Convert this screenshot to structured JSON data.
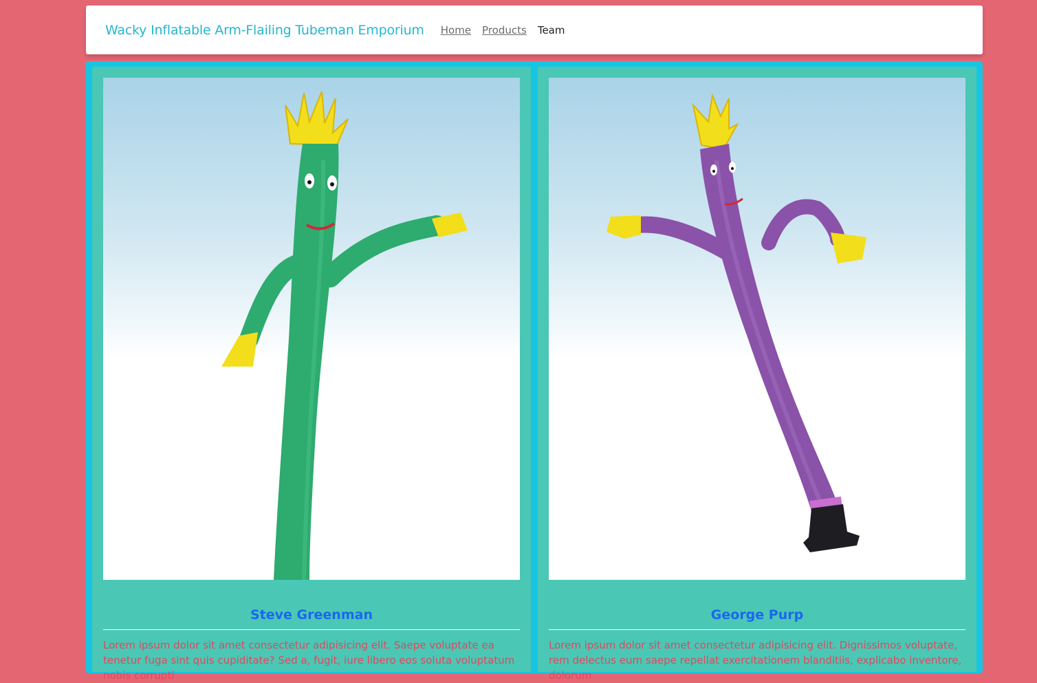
{
  "navbar": {
    "brand": "Wacky Inflatable Arm-Flailing Tubeman Emporium",
    "links": [
      {
        "label": "Home",
        "active": false
      },
      {
        "label": "Products",
        "active": false
      },
      {
        "label": "Team",
        "active": true
      }
    ]
  },
  "team": [
    {
      "name": "Steve Greenman",
      "image_icon": "green-tubeman-image",
      "tube_color": "#2eab6f",
      "description": "Lorem ipsum dolor sit amet consectetur adipisicing elit. Saepe voluptate ea tenetur fuga sint quis cupiditate? Sed a, fugit, iure libero eos soluta voluptatum nobis corrupti"
    },
    {
      "name": "George Purp",
      "image_icon": "purple-tubeman-image",
      "tube_color": "#8a52a8",
      "description": "Lorem ipsum dolor sit amet consectetur adipisicing elit. Dignissimos voluptate, rem delectus eum saepe repellat exercitationem blanditiis, explicabo inventore, dolorum"
    }
  ],
  "colors": {
    "page_background": "#e46672",
    "brand": "#25b6cf",
    "container": "#17c5e3",
    "card": "#4bc7b5",
    "member_name": "#1a67f0",
    "description_text": "#dd4a5e"
  }
}
